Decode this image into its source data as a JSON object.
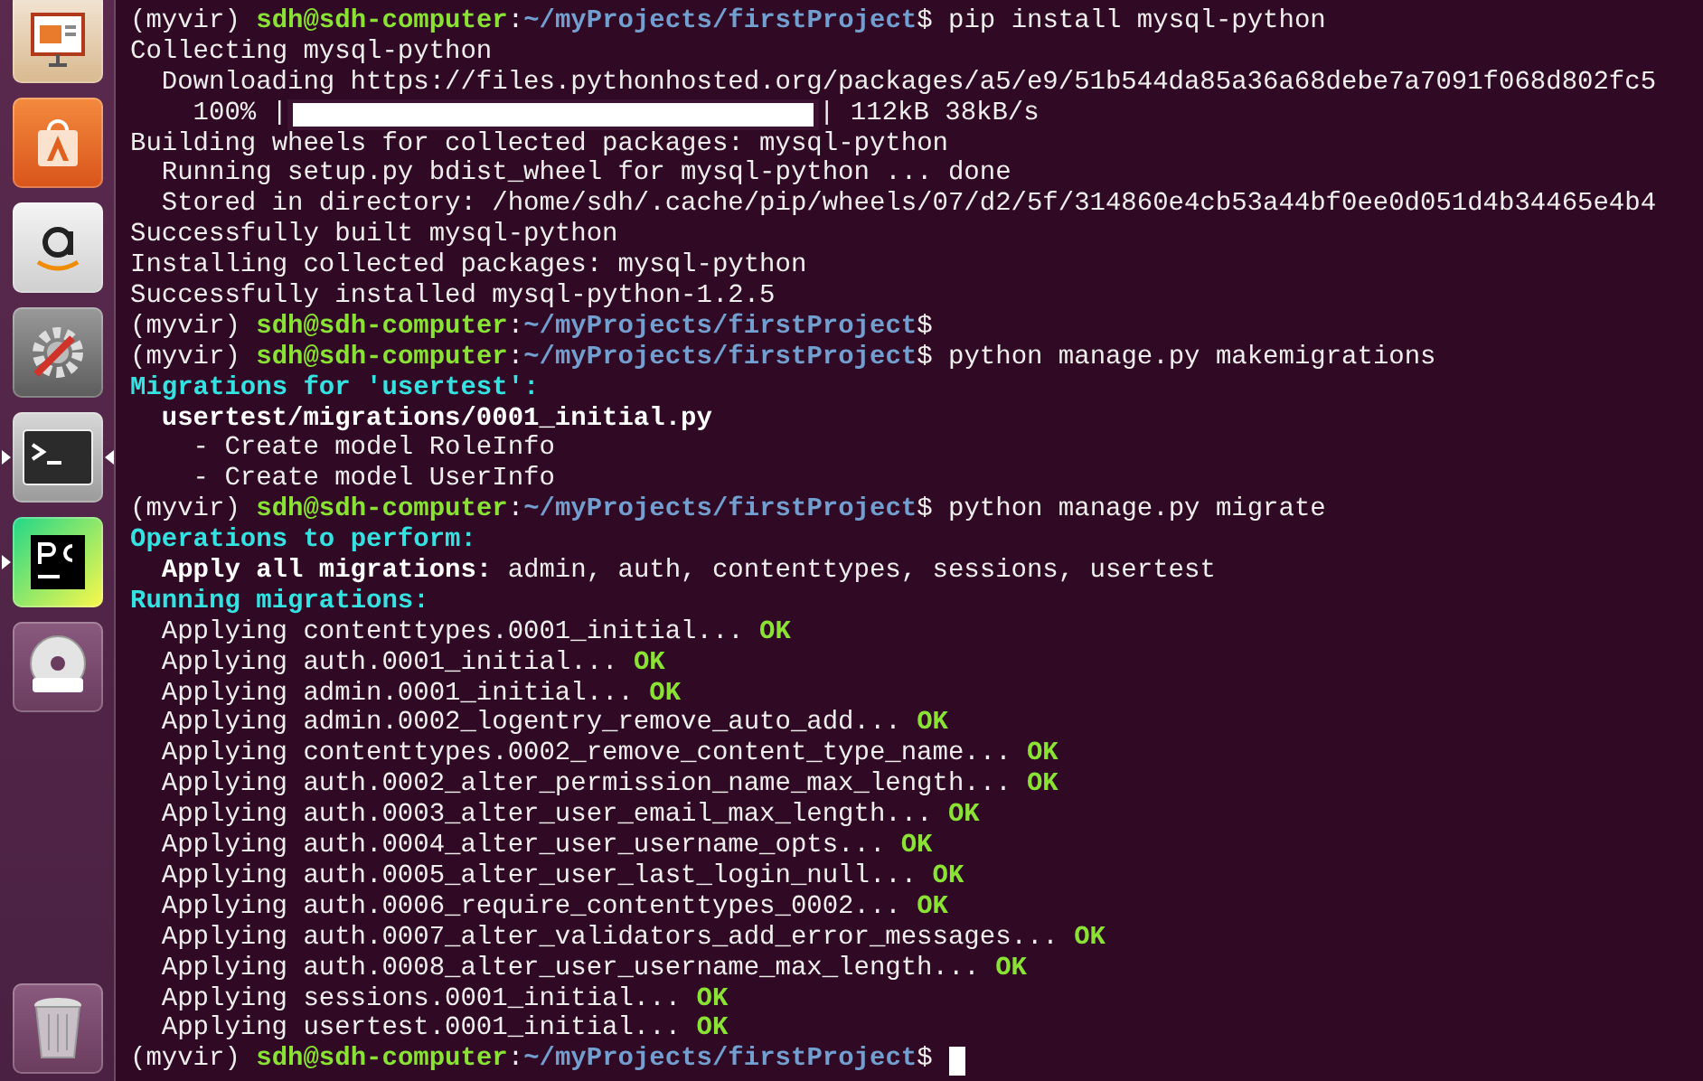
{
  "launcher": [
    {
      "kind": "presentation",
      "running": false,
      "active": false
    },
    {
      "kind": "software",
      "running": false,
      "active": false
    },
    {
      "kind": "amazon",
      "running": false,
      "active": false
    },
    {
      "kind": "settings",
      "running": false,
      "active": false
    },
    {
      "kind": "terminal",
      "running": true,
      "active": true
    },
    {
      "kind": "pycharm",
      "running": true,
      "active": false
    },
    {
      "kind": "dvd",
      "running": false,
      "active": false
    },
    {
      "kind": "trash",
      "running": false,
      "active": false
    }
  ],
  "terminal": {
    "lines": [
      {
        "kind": "prompt",
        "env": "(myvir)",
        "user_host": "sdh@sdh-computer",
        "separator": ":",
        "path": "~/myProjects/firstProject",
        "symbol": "$",
        "command": "pip install mysql-python"
      },
      {
        "kind": "plain",
        "text": "Collecting mysql-python"
      },
      {
        "kind": "detail",
        "text": "Downloading https://files.pythonhosted.org/packages/a5/e9/51b544da85a36a68debe7a7091f068d802fc5"
      },
      {
        "kind": "progress",
        "percent": "100% |",
        "level": 1,
        "text": "| 112kB 38kB/s"
      },
      {
        "kind": "plain",
        "text": "Building wheels for collected packages: mysql-python"
      },
      {
        "kind": "detail",
        "text": "Running setup.py bdist_wheel for mysql-python ... done"
      },
      {
        "kind": "detail",
        "text": "Stored in directory: /home/sdh/.cache/pip/wheels/07/d2/5f/314860e4cb53a44bf0ee0d051d4b34465e4b4"
      },
      {
        "kind": "plain",
        "text": "Successfully built mysql-python"
      },
      {
        "kind": "plain",
        "text": "Installing collected packages: mysql-python"
      },
      {
        "kind": "plain",
        "text": "Successfully installed mysql-python-1.2.5"
      },
      {
        "kind": "prompt",
        "env": "(myvir)",
        "user_host": "sdh@sdh-computer",
        "separator": ":",
        "path": "~/myProjects/firstProject",
        "symbol": "$"
      },
      {
        "kind": "prompt",
        "env": "(myvir)",
        "user_host": "sdh@sdh-computer",
        "separator": ":",
        "path": "~/myProjects/firstProject",
        "symbol": "$",
        "command": "python manage.py makemigrations"
      },
      {
        "kind": "heading",
        "text": "Migrations for 'usertest':"
      },
      {
        "kind": "bold",
        "text": "usertest/migrations/0001_initial.py"
      },
      {
        "kind": "sub_detail",
        "text": "- Create model RoleInfo"
      },
      {
        "kind": "sub_detail",
        "text": "- Create model UserInfo"
      },
      {
        "kind": "prompt",
        "env": "(myvir)",
        "user_host": "sdh@sdh-computer",
        "separator": ":",
        "path": "~/myProjects/firstProject",
        "symbol": "$",
        "command": "python manage.py migrate"
      },
      {
        "kind": "heading",
        "text": "Operations to perform:"
      },
      {
        "kind": "labeled",
        "label": "Apply all migrations:",
        "text": "admin, auth, contenttypes, sessions, usertest"
      },
      {
        "kind": "heading",
        "text": "Running migrations:"
      },
      {
        "kind": "applying",
        "text": "Applying contenttypes.0001_initial...",
        "status": "OK"
      },
      {
        "kind": "applying",
        "text": "Applying auth.0001_initial...",
        "status": "OK"
      },
      {
        "kind": "applying",
        "text": "Applying admin.0001_initial...",
        "status": "OK"
      },
      {
        "kind": "applying",
        "text": "Applying admin.0002_logentry_remove_auto_add...",
        "status": "OK"
      },
      {
        "kind": "applying",
        "text": "Applying contenttypes.0002_remove_content_type_name...",
        "status": "OK"
      },
      {
        "kind": "applying",
        "text": "Applying auth.0002_alter_permission_name_max_length...",
        "status": "OK"
      },
      {
        "kind": "applying",
        "text": "Applying auth.0003_alter_user_email_max_length...",
        "status": "OK"
      },
      {
        "kind": "applying",
        "text": "Applying auth.0004_alter_user_username_opts...",
        "status": "OK"
      },
      {
        "kind": "applying",
        "text": "Applying auth.0005_alter_user_last_login_null...",
        "status": "OK"
      },
      {
        "kind": "applying",
        "text": "Applying auth.0006_require_contenttypes_0002...",
        "status": "OK"
      },
      {
        "kind": "applying",
        "text": "Applying auth.0007_alter_validators_add_error_messages...",
        "status": "OK"
      },
      {
        "kind": "applying",
        "text": "Applying auth.0008_alter_user_username_max_length...",
        "status": "OK"
      },
      {
        "kind": "applying",
        "text": "Applying sessions.0001_initial...",
        "status": "OK"
      },
      {
        "kind": "applying",
        "text": "Applying usertest.0001_initial...",
        "status": "OK"
      },
      {
        "kind": "prompt",
        "env": "(myvir)",
        "user_host": "sdh@sdh-computer",
        "separator": ":",
        "path": "~/myProjects/firstProject",
        "symbol": "$",
        "cursor": true
      }
    ]
  }
}
